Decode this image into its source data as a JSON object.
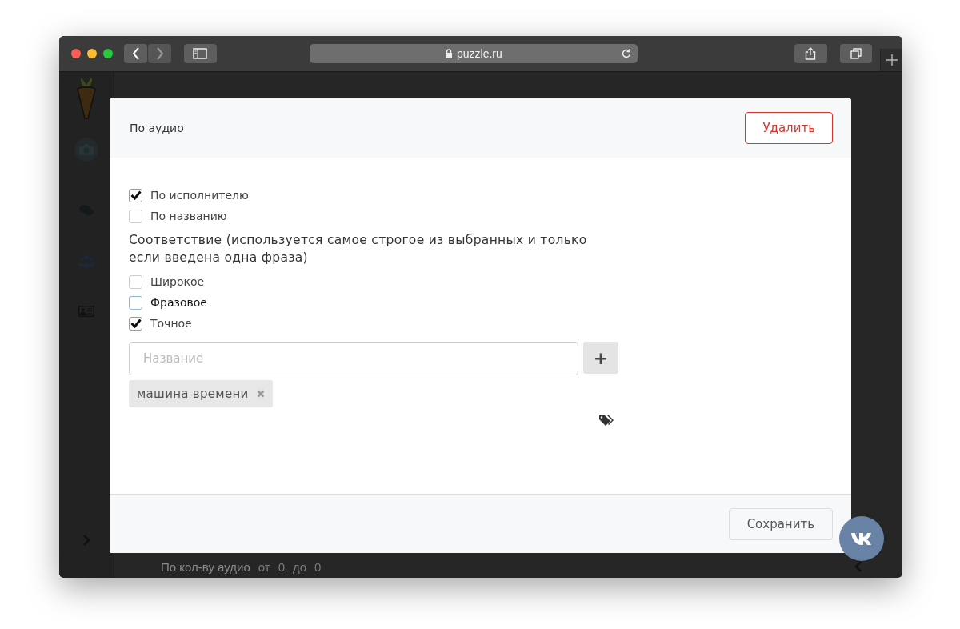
{
  "browser": {
    "address": "puzzle.ru"
  },
  "background": {
    "filter_label": "По кол-ву аудио",
    "from_label": "от",
    "from_value": "0",
    "to_label": "до",
    "to_value": "0"
  },
  "modal": {
    "title": "По аудио",
    "delete_button": "Удалить",
    "search_options": [
      {
        "label": "По исполнителю",
        "checked": true,
        "focused": false
      },
      {
        "label": "По названию",
        "checked": false,
        "focused": false
      }
    ],
    "match_heading": "Соответствие (используется самое строгое из выбранных и только если введена одна фраза)",
    "match_options": [
      {
        "label": "Широкое",
        "checked": false,
        "focused": false
      },
      {
        "label": "Фразовое",
        "checked": false,
        "focused": true
      },
      {
        "label": "Точное",
        "checked": true,
        "focused": false
      }
    ],
    "name_field": {
      "placeholder": "Название"
    },
    "add_button": "+",
    "tags": [
      {
        "label": "машина времени"
      }
    ],
    "save_button": "Сохранить"
  }
}
